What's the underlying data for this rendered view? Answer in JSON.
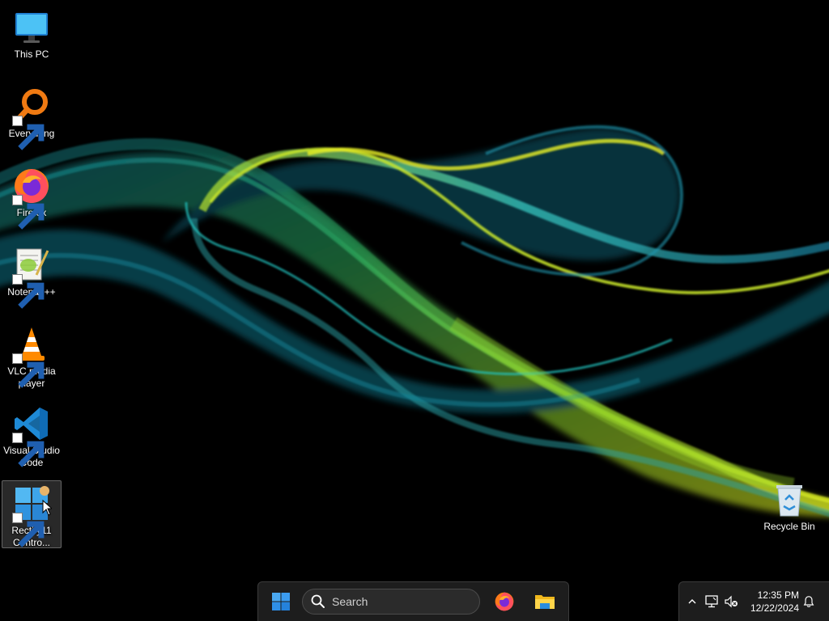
{
  "desktop": {
    "icons": [
      {
        "label_line1": "This PC",
        "label_line2": "",
        "icon": "monitor-icon"
      },
      {
        "label_line1": "Everything",
        "label_line2": "",
        "icon": "everything-search-icon"
      },
      {
        "label_line1": "Firefox",
        "label_line2": "",
        "icon": "firefox-icon"
      },
      {
        "label_line1": "Notepad++",
        "label_line2": "",
        "icon": "notepad-plus-plus-icon"
      },
      {
        "label_line1": "VLC media",
        "label_line2": "player",
        "icon": "vlc-cone-icon"
      },
      {
        "label_line1": "Visual Studio",
        "label_line2": "Code",
        "icon": "vscode-icon"
      },
      {
        "label_line1": "Rectify11",
        "label_line2": "Contro...",
        "icon": "rectify11-control-panel-icon",
        "selected": true
      }
    ],
    "recycle_bin": {
      "label": "Recycle Bin",
      "icon": "recycle-bin-icon"
    }
  },
  "taskbar": {
    "start_icon": "windows-start-icon",
    "search": {
      "placeholder": "Search",
      "icon": "search-icon"
    },
    "pinned": [
      {
        "name": "Firefox",
        "icon": "firefox-icon"
      },
      {
        "name": "File Explorer",
        "icon": "folder-icon"
      }
    ]
  },
  "tray": {
    "overflow_icon": "chevron-up-icon",
    "network_icon": "network-monitor-icon",
    "volume_icon": "volume-muted-icon",
    "time": "12:35 PM",
    "date": "12/22/2024",
    "notification_icon": "bell-icon"
  },
  "colors": {
    "taskbar_bg": "#202020",
    "wave_green": "#7fd32a",
    "wave_yellow": "#e4f21e",
    "wave_cyan": "#1fb7c9",
    "accent": "#3b9cf0"
  }
}
